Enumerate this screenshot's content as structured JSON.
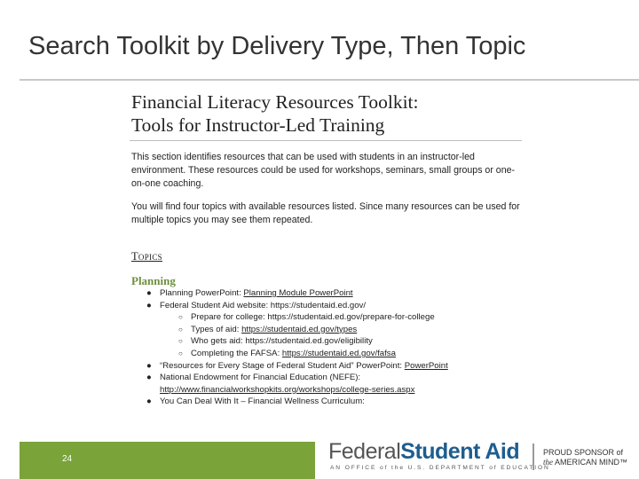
{
  "slide": {
    "title": "Search Toolkit by Delivery Type, Then Topic",
    "page_number": "24"
  },
  "document": {
    "title_line1": "Financial Literacy Resources Toolkit:",
    "title_line2": "Tools for Instructor-Led Training",
    "paragraph1": "This section identifies resources that can be used with students in an instructor-led environment. These resources could be used for workshops, seminars, small groups or one-on-one coaching.",
    "paragraph2": "You will find four topics with available resources listed. Since many resources can be used for multiple topics you may see them repeated.",
    "topics_heading": "Topics",
    "planning_heading": "Planning",
    "items": {
      "i1_label": "Planning PowerPoint: ",
      "i1_link": "Planning Module PowerPoint",
      "i2_label": "Federal Student Aid website: https://studentaid.ed.gov/",
      "s1_label": "Prepare for college: https://studentaid.ed.gov/prepare-for-college",
      "s2_label": "Types of aid: ",
      "s2_link": "https://studentaid.ed.gov/types",
      "s3_label": "Who gets aid:  https://studentaid.ed.gov/eligibility",
      "s4_label": "Completing the FAFSA: ",
      "s4_link": "https://studentaid.ed.gov/fafsa",
      "i3_label": "“Resources for Every Stage of Federal Student Aid” PowerPoint: ",
      "i3_link": "PowerPoint",
      "i4_label": "National Endowment for Financial Education (NEFE):",
      "i4_link": "http://www.financialworkshopkits.org/workshops/college-series.aspx",
      "i5_label": "You Can Deal With It – Financial Wellness Curriculum:"
    }
  },
  "footer": {
    "logo_light": "Federal",
    "logo_bold": "Student Aid",
    "logo_tagline": "AN OFFICE of the U.S. DEPARTMENT of EDUCATION",
    "sponsor_line1": "PROUD SPONSOR of",
    "sponsor_line2_italic": "the",
    "sponsor_line2": " AMERICAN MIND™",
    "green_bar_color": "#7aa33a",
    "logo_blue": "#1f5d8e"
  }
}
